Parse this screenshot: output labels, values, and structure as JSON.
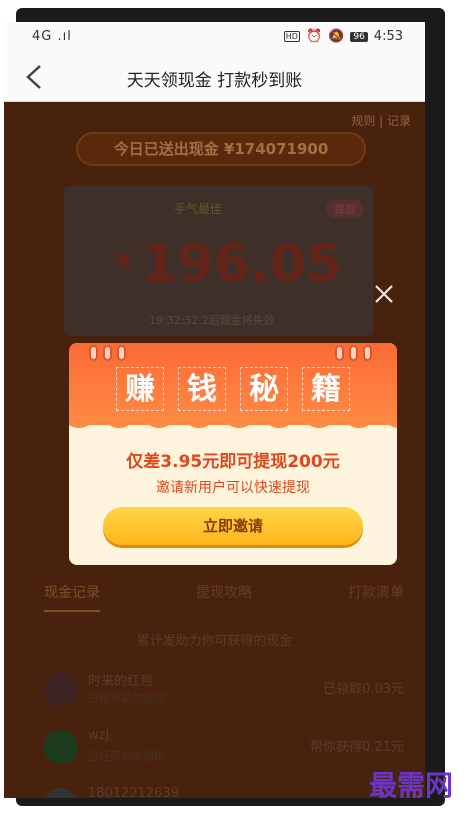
{
  "status_bar": {
    "signal": "4G .ıl",
    "hd": "HD",
    "battery": "96",
    "time": "4:53"
  },
  "nav": {
    "title": "天天领现金 打款秒到账"
  },
  "background": {
    "rules_link": "规则 | 记录",
    "sent_banner": "今日已送出现金 ¥174071900",
    "card_label": "手气最佳",
    "withdraw_label": "提现",
    "currency": "¥",
    "amount": "196.05",
    "expire_text": "19:32:32.2后现金将失效",
    "tabs": [
      "现金记录",
      "提现攻略",
      "打款清单"
    ],
    "tip": "累计发助力你可获得的现金",
    "records": [
      {
        "name": "时来的红包",
        "sub": "已经帮助你提现",
        "amount": "已领取0.03元"
      },
      {
        "name": "wzj",
        "sub": "已经帮助你提现",
        "amount": "帮你获得0.21元"
      },
      {
        "name": "18012212639",
        "sub": "",
        "amount": ""
      }
    ]
  },
  "modal": {
    "title_chars": [
      "赚",
      "钱",
      "秘",
      "籍"
    ],
    "line1": "仅差3.95元即可提现200元",
    "line2": "邀请新用户可以快速提现",
    "button": "立即邀请"
  },
  "watermark": "最需网",
  "colors": {
    "modal_head": "#fa6a36",
    "accent_red": "#e0481c",
    "button_yellow": "#ffc22a",
    "watermark": "#6b36c6"
  }
}
